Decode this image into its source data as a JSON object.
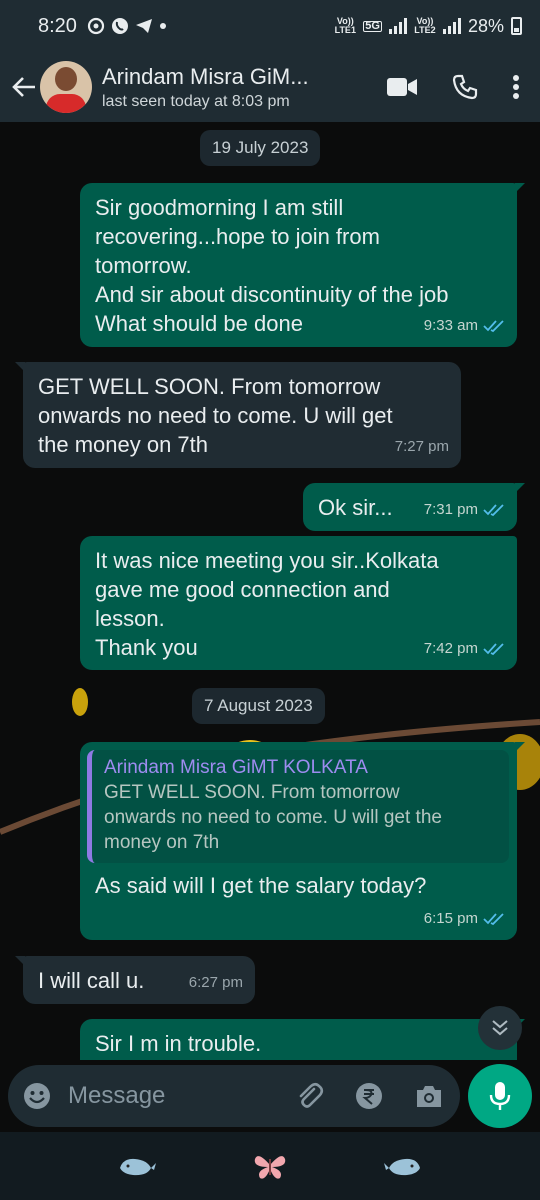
{
  "status_bar": {
    "time": "8:20",
    "sim1_label": "Vo)) LTE1",
    "network_label": "5G",
    "sim2_label": "Vo)) LTE2",
    "battery": "28%"
  },
  "header": {
    "contact_name": "Arindam Misra GiM...",
    "last_seen": "last seen today at 8:03 pm"
  },
  "chat": {
    "date1": "19 July 2023",
    "date2": "7 August 2023",
    "messages": [
      {
        "text": "Sir goodmorning I am still\nrecovering...hope to join from\ntomorrow.\nAnd sir about discontinuity of the job\nWhat should be done",
        "time": "9:33 am",
        "direction": "out"
      },
      {
        "text": "GET WELL SOON. From tomorrow\nonwards no need to come. U will get\nthe money on 7th",
        "time": "7:27 pm",
        "direction": "in"
      },
      {
        "text": "Ok sir...",
        "time": "7:31 pm",
        "direction": "out"
      },
      {
        "text": "It was nice meeting you sir..Kolkata\ngave me good connection and\nlesson.\nThank you",
        "time": "7:42 pm",
        "direction": "out"
      },
      {
        "text": "As said will I get the salary today?",
        "time": "6:15 pm",
        "direction": "out",
        "quote_name": "Arindam Misra GiMT KOLKATA",
        "quote_text": "GET WELL SOON. From tomorrow\nonwards no need to come. U will get the\nmoney on 7th"
      },
      {
        "text": "I will call u.",
        "time": "6:27 pm",
        "direction": "in"
      },
      {
        "text": "Sir I m in trouble.",
        "time": "",
        "direction": "out"
      }
    ]
  },
  "input": {
    "placeholder": "Message"
  },
  "colors": {
    "outgoing_bubble": "#005c4b",
    "incoming_bubble": "#202c33",
    "accent": "#00a884",
    "read_ticks": "#53bdeb"
  }
}
